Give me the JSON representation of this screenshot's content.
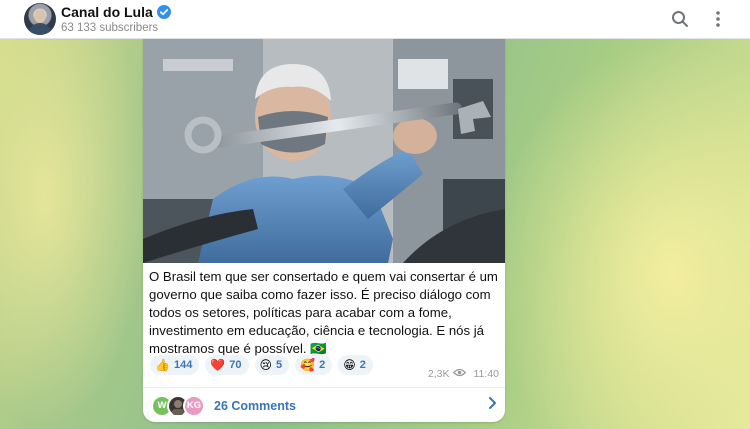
{
  "header": {
    "title": "Canal do Lula",
    "subtitle": "63 133 subscribers"
  },
  "post": {
    "text": "O Brasil tem que ser consertado e quem vai consertar é um governo que saiba como fazer isso. É preciso diálogo com todos os setores, políticas para acabar com a fome, investimento em educação, ciência e tecnologia. E nós já mostramos que é possível. 🇧🇷",
    "reactions": [
      {
        "emoji": "👍",
        "count": "144"
      },
      {
        "emoji": "❤️",
        "count": "70"
      },
      {
        "emoji": "😢",
        "count": "5"
      },
      {
        "emoji": "🥰",
        "count": "2"
      },
      {
        "emoji": "😁",
        "count": "2"
      }
    ],
    "views": "2,3K",
    "time": "11:40"
  },
  "comments": {
    "label": "26 Comments",
    "avatars": [
      "W",
      "",
      "KG"
    ]
  },
  "colors": {
    "accent": "#3a76b1",
    "verified": "#3390ec"
  }
}
